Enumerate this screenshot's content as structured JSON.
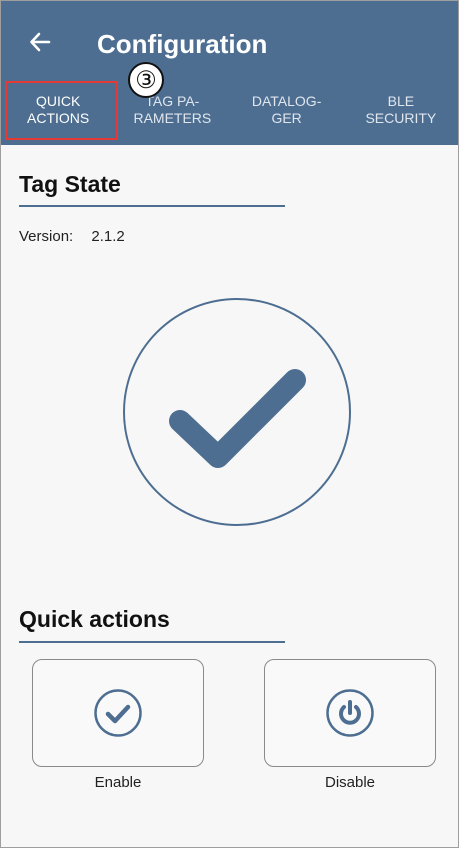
{
  "header": {
    "title": "Configuration",
    "back_icon": "arrow-left-icon"
  },
  "tabs": [
    {
      "label": "QUICK\nACTIONS",
      "active": true
    },
    {
      "label": "TAG PA-\nRAMETERS",
      "active": false
    },
    {
      "label": "DATALOG-\nGER",
      "active": false
    },
    {
      "label": "BLE\nSECURITY",
      "active": false
    }
  ],
  "annotation": {
    "step_marker": "③",
    "highlight_color": "#e53935"
  },
  "tag_state": {
    "title": "Tag State",
    "version_label": "Version:",
    "version_value": "2.1.2",
    "state_icon": "check-circle-icon"
  },
  "quick_actions": {
    "title": "Quick actions",
    "enable_label": "Enable",
    "enable_icon": "check-circle-icon",
    "disable_label": "Disable",
    "disable_icon": "power-icon"
  },
  "colors": {
    "primary": "#4d6e91",
    "background": "#f7f7f7"
  }
}
